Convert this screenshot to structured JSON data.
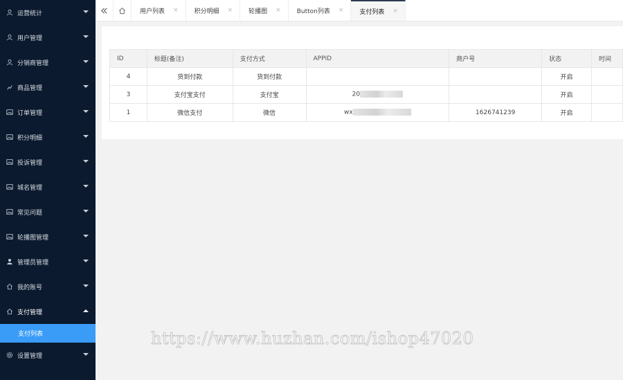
{
  "sidebar": {
    "items": [
      {
        "label": "运营统计",
        "icon": "user-icon"
      },
      {
        "label": "用户管理",
        "icon": "user-icon"
      },
      {
        "label": "分销商管理",
        "icon": "user-icon"
      },
      {
        "label": "商品管理",
        "icon": "chart-icon"
      },
      {
        "label": "订单管理",
        "icon": "image-icon"
      },
      {
        "label": "积分明细",
        "icon": "image-icon"
      },
      {
        "label": "投诉管理",
        "icon": "image-icon"
      },
      {
        "label": "城名管理",
        "icon": "image-icon"
      },
      {
        "label": "常见问题",
        "icon": "image-icon"
      },
      {
        "label": "轮播图管理",
        "icon": "image-icon"
      },
      {
        "label": "管理员管理",
        "icon": "person-icon"
      },
      {
        "label": "我的账号",
        "icon": "home-icon"
      },
      {
        "label": "支付管理",
        "icon": "home-icon"
      },
      {
        "label": "设置管理",
        "icon": "gear-icon"
      }
    ],
    "open_item": "支付管理",
    "submenu": [
      {
        "label": "支付列表"
      }
    ],
    "active_color": "#3a9cf7",
    "bg_color": "#0b1a2e"
  },
  "tabs": [
    {
      "label": "用户列表",
      "active": false
    },
    {
      "label": "积分明细",
      "active": false
    },
    {
      "label": "轮播图",
      "active": false
    },
    {
      "label": "Button列表",
      "active": false
    },
    {
      "label": "支付列表",
      "active": true
    }
  ],
  "tab_close_glyph": "×",
  "table": {
    "columns": [
      "ID",
      "标题(备注)",
      "支付方式",
      "APPID",
      "商户号",
      "状态",
      "时间"
    ],
    "rows": [
      {
        "id": "4",
        "title": "货到付款",
        "method": "货到付款",
        "appid_prefix": "",
        "merchant": "",
        "status": "开启",
        "time": ""
      },
      {
        "id": "3",
        "title": "支付宝支付",
        "method": "支付宝",
        "appid_prefix": "20",
        "merchant": "",
        "status": "开启",
        "time": ""
      },
      {
        "id": "1",
        "title": "微信支付",
        "method": "微信",
        "appid_prefix": "wx",
        "merchant": "1626741239",
        "status": "开启",
        "time": ""
      }
    ]
  },
  "watermark": "https://www.huzhan.com/ishop47020"
}
